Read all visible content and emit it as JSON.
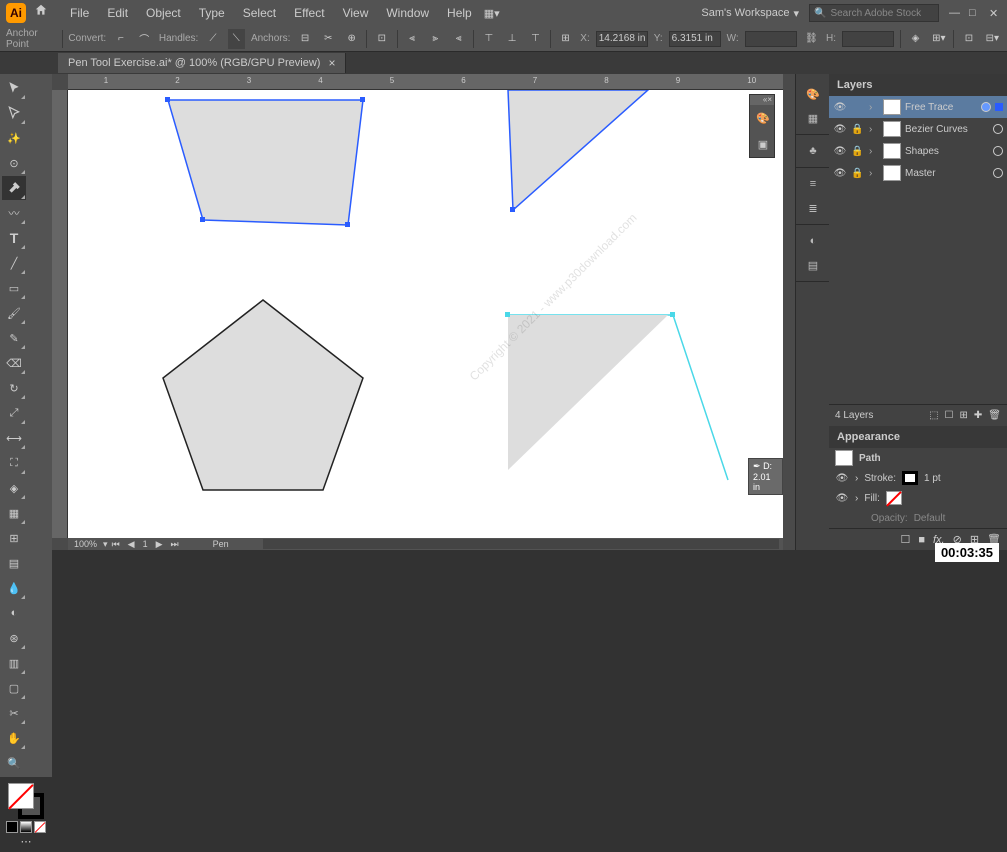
{
  "app": {
    "initials": "Ai"
  },
  "menu": [
    "File",
    "Edit",
    "Object",
    "Type",
    "Select",
    "Effect",
    "View",
    "Window",
    "Help"
  ],
  "workspace": "Sam's Workspace",
  "search": {
    "placeholder": "Search Adobe Stock"
  },
  "controlbar": {
    "anchor": "Anchor Point",
    "convert": "Convert:",
    "handles": "Handles:",
    "anchors": "Anchors:",
    "x_label": "X:",
    "x": "14.2168 in",
    "y_label": "Y:",
    "y": "6.3151 in",
    "w_label": "W:",
    "w": "",
    "h_label": "H:",
    "h": ""
  },
  "tab": {
    "title": "Pen Tool Exercise.ai* @ 100% (RGB/GPU Preview)"
  },
  "rulers": {
    "h": [
      "1",
      "2",
      "3",
      "4",
      "5",
      "6",
      "7",
      "8",
      "9",
      "10"
    ]
  },
  "status": {
    "zoom": "100%",
    "tool": "Pen"
  },
  "tooltip": {
    "d": "D: 2.01 in"
  },
  "layers_panel": {
    "title": "Layers",
    "items": [
      {
        "name": "Free Trace",
        "selected": true,
        "locked": false
      },
      {
        "name": "Bezier Curves",
        "selected": false,
        "locked": true
      },
      {
        "name": "Shapes",
        "selected": false,
        "locked": true
      },
      {
        "name": "Master",
        "selected": false,
        "locked": true
      }
    ],
    "count": "4 Layers"
  },
  "appearance": {
    "title": "Appearance",
    "object": "Path",
    "stroke_label": "Stroke:",
    "stroke_value": "1 pt",
    "fill_label": "Fill:",
    "opacity_label": "Opacity:",
    "opacity_value": "Default"
  },
  "timecode": "00:03:35",
  "watermark": "Copyright © 2021 - www.p30download.com"
}
